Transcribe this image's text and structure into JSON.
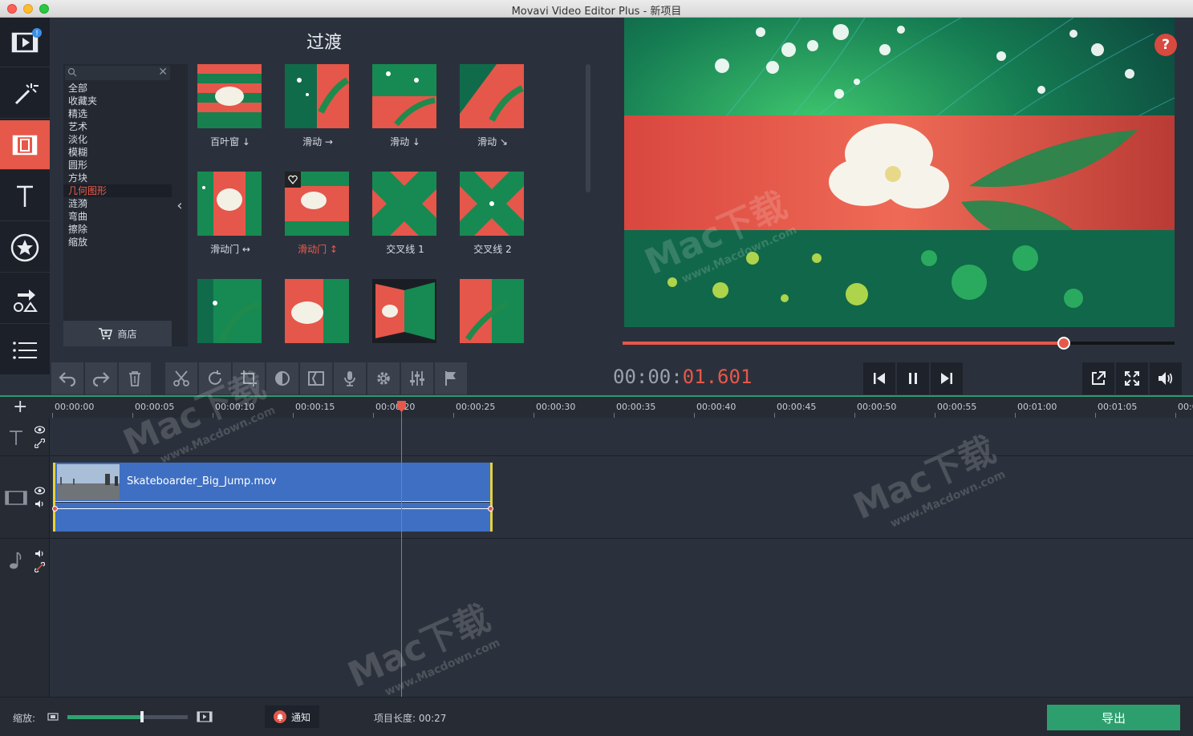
{
  "window": {
    "title": "Movavi Video Editor Plus - 新项目"
  },
  "sidebar": {
    "items": [
      {
        "name": "import-media",
        "icon": "film-import-icon"
      },
      {
        "name": "filters",
        "icon": "magic-wand-icon"
      },
      {
        "name": "transitions",
        "icon": "transitions-icon",
        "active": true
      },
      {
        "name": "titles",
        "icon": "text-icon"
      },
      {
        "name": "stickers",
        "icon": "star-sticker-icon"
      },
      {
        "name": "callouts",
        "icon": "shapes-icon"
      },
      {
        "name": "more",
        "icon": "menu-list-icon"
      }
    ]
  },
  "panel": {
    "title": "过渡",
    "categories": [
      "全部",
      "收藏夹",
      "精选",
      "艺术",
      "淡化",
      "模糊",
      "圆形",
      "方块",
      "几何图形",
      "涟漪",
      "弯曲",
      "擦除",
      "缩放"
    ],
    "selected_category": "几何图形",
    "store_label": "商店",
    "transitions": [
      {
        "label": "百叶窗 ↓"
      },
      {
        "label": "滑动 →"
      },
      {
        "label": "滑动 ↓"
      },
      {
        "label": "滑动 ↘"
      },
      {
        "label": "滑动门 ↔"
      },
      {
        "label": "滑动门 ↕",
        "selected": true
      },
      {
        "label": "交叉线 1"
      },
      {
        "label": "交叉线 2"
      },
      {
        "label": ""
      },
      {
        "label": ""
      },
      {
        "label": ""
      },
      {
        "label": ""
      }
    ]
  },
  "preview": {
    "help_label": "?",
    "progress": 0.8,
    "timecode_dim": "00:00:",
    "timecode_hi": "01.601"
  },
  "timeline": {
    "ruler": [
      "00:00:00",
      "00:00:05",
      "00:00:10",
      "00:00:15",
      "00:00:20",
      "00:00:25",
      "00:00:30",
      "00:00:35",
      "00:00:40",
      "00:00:45",
      "00:00:50",
      "00:00:55",
      "00:01:00",
      "00:01:05",
      "00:0"
    ],
    "add_label": "+",
    "clip_name": "Skateboarder_Big_Jump.mov"
  },
  "status": {
    "zoom_label": "缩放:",
    "zoom_level": 0.62,
    "notify_label": "通知",
    "project_length": "项目长度:  00:27",
    "export_label": "导出"
  },
  "watermark": {
    "text": "Mac下载",
    "url": "www.Macdown.com"
  },
  "colors": {
    "accent": "#e6584a",
    "export": "#2d9f6e",
    "clip": "#3e6fc2",
    "clip_border": "#e6d23a"
  }
}
